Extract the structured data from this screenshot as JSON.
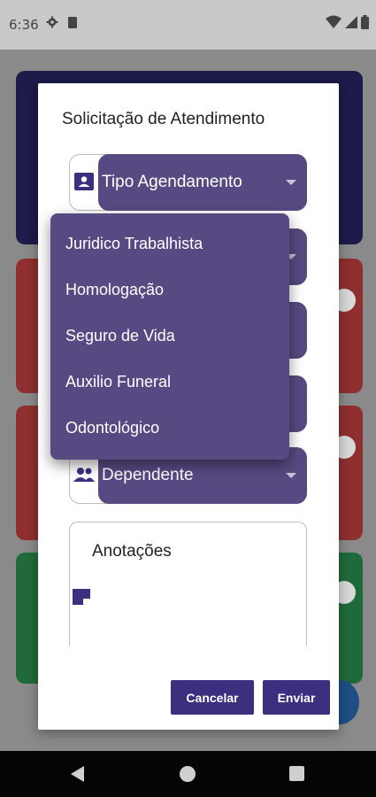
{
  "status_bar": {
    "time": "6:36",
    "icons": [
      "gear-icon",
      "sd-card-icon",
      "wifi-icon",
      "signal-icon",
      "battery-icon"
    ]
  },
  "dialog": {
    "title": "Solicitação de Atendimento",
    "fields": {
      "tipo_agendamento": {
        "label": "Tipo Agendamento",
        "icon": "contact-card-icon"
      },
      "dependente": {
        "label": "Dependente",
        "icon": "people-icon"
      }
    },
    "notes": {
      "label": "Anotações",
      "icon": "note-icon"
    },
    "buttons": {
      "cancel": "Cancelar",
      "send": "Enviar"
    }
  },
  "dropdown": {
    "items": [
      "Juridico Trabalhista",
      "Homologação",
      "Seguro de Vida",
      "Auxilio Funeral",
      "Odontológico"
    ]
  },
  "navbar": {
    "icons": [
      "back-icon",
      "home-icon",
      "recents-icon"
    ]
  },
  "colors": {
    "accent": "#574a82",
    "button": "#3d2f80",
    "navy_card": "#1c1b4a",
    "red_card": "#8f2f2f",
    "green_card": "#1f6a3a"
  }
}
